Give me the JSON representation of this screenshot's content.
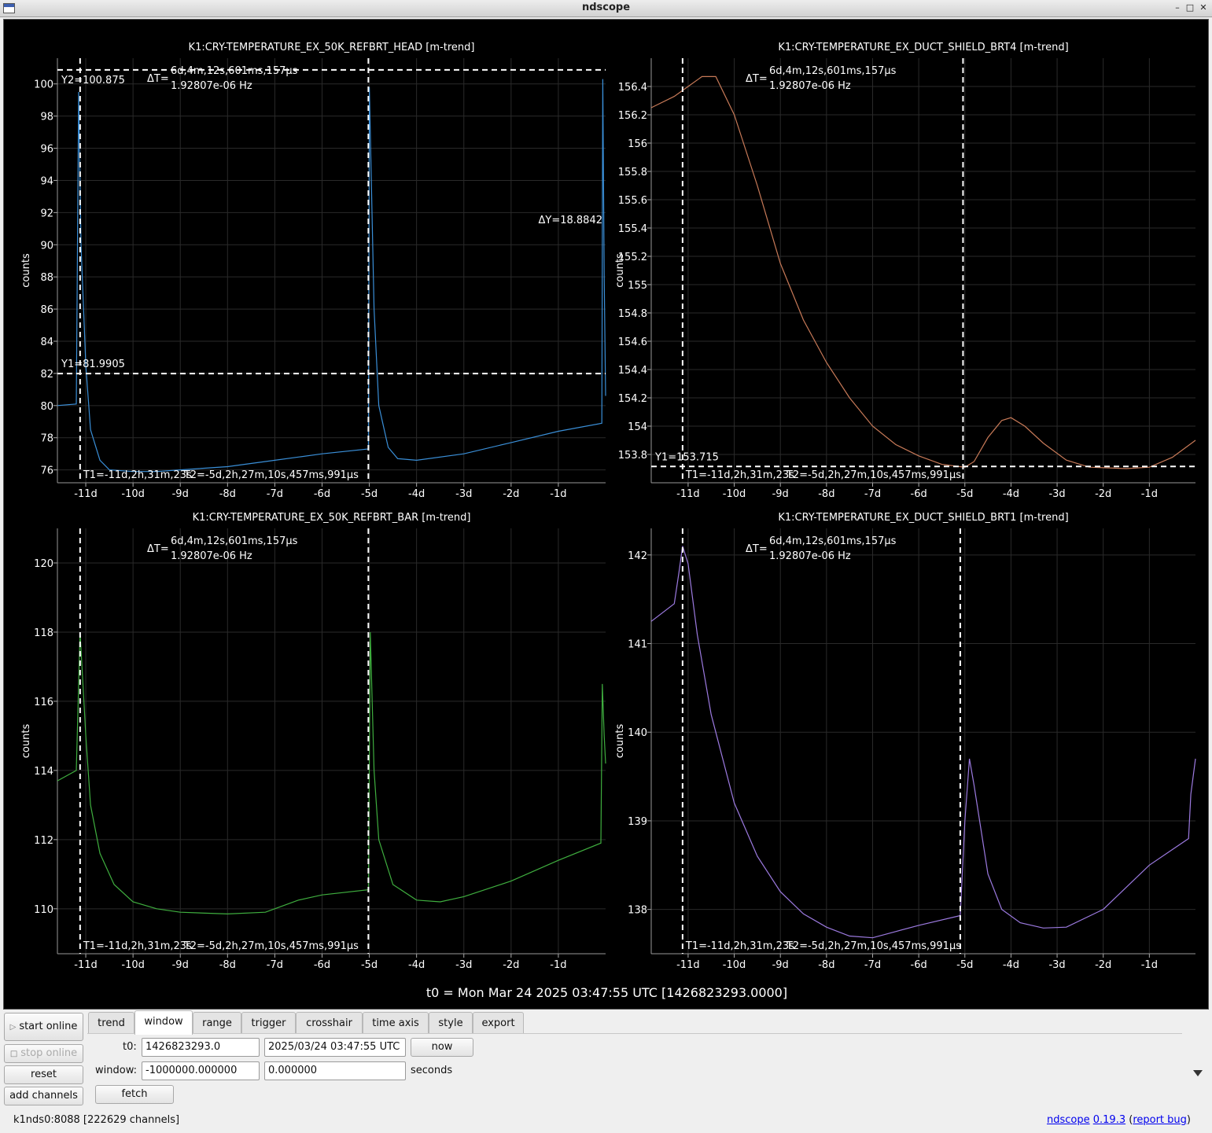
{
  "window": {
    "title": "ndscope"
  },
  "plots": [
    {
      "title": "K1:CRY-TEMPERATURE_EX_50K_REFBRT_HEAD [m-trend]",
      "ylabel": "counts",
      "color": "#3a8fd8",
      "ylim": [
        75.2,
        101.6
      ],
      "yticks": [
        "76",
        "78",
        "80",
        "82",
        "84",
        "86",
        "88",
        "90",
        "92",
        "94",
        "96",
        "98",
        "100"
      ],
      "xticks": [
        "-11d",
        "-10d",
        "-9d",
        "-8d",
        "-7d",
        "-6d",
        "-5d",
        "-4d",
        "-3d",
        "-2d",
        "-1d"
      ],
      "trace": [
        [
          -11.6,
          80.0
        ],
        [
          -11.2,
          80.1
        ],
        [
          -11.15,
          99.5
        ],
        [
          -11.1,
          90
        ],
        [
          -11.0,
          82.5
        ],
        [
          -10.9,
          78.5
        ],
        [
          -10.7,
          76.6
        ],
        [
          -10.5,
          76.0
        ],
        [
          -10.0,
          75.9
        ],
        [
          -9.5,
          75.9
        ],
        [
          -9.0,
          76.0
        ],
        [
          -8.0,
          76.2
        ],
        [
          -7.0,
          76.6
        ],
        [
          -6.0,
          77.0
        ],
        [
          -5.02,
          77.3
        ],
        [
          -5.0,
          99.8
        ],
        [
          -4.9,
          86
        ],
        [
          -4.8,
          80
        ],
        [
          -4.6,
          77.4
        ],
        [
          -4.4,
          76.7
        ],
        [
          -4.0,
          76.6
        ],
        [
          -3.0,
          77.0
        ],
        [
          -2.0,
          77.7
        ],
        [
          -1.0,
          78.4
        ],
        [
          -0.08,
          78.9
        ],
        [
          -0.06,
          100.3
        ],
        [
          -0.03,
          88
        ],
        [
          0.0,
          80.6
        ]
      ],
      "cursors": {
        "t1_label": "T1=-11d,2h,31m,23s",
        "t2_label": "T2=-5d,2h,27m,10s,457ms,991µs",
        "dt_label": "ΔT=",
        "dt_value": "6d,4m,12s,601ms,157µs",
        "dt_freq": "1.92807e-06 Hz",
        "y1_label": "Y1=81.9905",
        "y2_label": "Y2=100.875",
        "dy_label": "ΔY=18.8842",
        "y1": 81.9905,
        "y2": 100.875
      }
    },
    {
      "title": "K1:CRY-TEMPERATURE_EX_DUCT_SHIELD_BRT4 [m-trend]",
      "ylabel": "counts",
      "color": "#c87a58",
      "ylim": [
        153.6,
        156.6
      ],
      "yticks": [
        "153.8",
        "154",
        "154.2",
        "154.4",
        "154.6",
        "154.8",
        "155",
        "155.2",
        "155.4",
        "155.6",
        "155.8",
        "156",
        "156.2",
        "156.4"
      ],
      "xticks": [
        "-11d",
        "-10d",
        "-9d",
        "-8d",
        "-7d",
        "-6d",
        "-5d",
        "-4d",
        "-3d",
        "-2d",
        "-1d"
      ],
      "trace": [
        [
          -11.8,
          156.25
        ],
        [
          -11.3,
          156.33
        ],
        [
          -11.0,
          156.4
        ],
        [
          -10.7,
          156.47
        ],
        [
          -10.4,
          156.47
        ],
        [
          -10.0,
          156.2
        ],
        [
          -9.5,
          155.7
        ],
        [
          -9.0,
          155.15
        ],
        [
          -8.5,
          154.75
        ],
        [
          -8.0,
          154.45
        ],
        [
          -7.5,
          154.2
        ],
        [
          -7.0,
          154.0
        ],
        [
          -6.5,
          153.87
        ],
        [
          -6.0,
          153.79
        ],
        [
          -5.5,
          153.73
        ],
        [
          -5.0,
          153.71
        ],
        [
          -4.8,
          153.75
        ],
        [
          -4.5,
          153.92
        ],
        [
          -4.2,
          154.04
        ],
        [
          -4.0,
          154.06
        ],
        [
          -3.7,
          154.0
        ],
        [
          -3.3,
          153.88
        ],
        [
          -2.8,
          153.76
        ],
        [
          -2.3,
          153.71
        ],
        [
          -1.5,
          153.7
        ],
        [
          -1.0,
          153.71
        ],
        [
          -0.5,
          153.78
        ],
        [
          0.0,
          153.9
        ]
      ],
      "cursors": {
        "t1_label": "T1=-11d,2h,31m,23s",
        "t2_label": "T2=-5d,2h,27m,10s,457ms,991µs",
        "dt_label": "ΔT=",
        "dt_value": "6d,4m,12s,601ms,157µs",
        "dt_freq": "1.92807e-06 Hz",
        "y1_label": "Y1=153.715",
        "y1": 153.715
      }
    },
    {
      "title": "K1:CRY-TEMPERATURE_EX_50K_REFBRT_BAR [m-trend]",
      "ylabel": "counts",
      "color": "#3fae3f",
      "ylim": [
        108.7,
        121.0
      ],
      "yticks": [
        "110",
        "112",
        "114",
        "116",
        "118",
        "120"
      ],
      "xticks": [
        "-11d",
        "-10d",
        "-9d",
        "-8d",
        "-7d",
        "-6d",
        "-5d",
        "-4d",
        "-3d",
        "-2d",
        "-1d"
      ],
      "trace": [
        [
          -11.6,
          113.7
        ],
        [
          -11.2,
          114.0
        ],
        [
          -11.12,
          118.0
        ],
        [
          -11.0,
          115.0
        ],
        [
          -10.9,
          113.0
        ],
        [
          -10.7,
          111.6
        ],
        [
          -10.4,
          110.7
        ],
        [
          -10.0,
          110.2
        ],
        [
          -9.5,
          110.0
        ],
        [
          -9.0,
          109.9
        ],
        [
          -8.0,
          109.85
        ],
        [
          -7.2,
          109.9
        ],
        [
          -7.0,
          110.0
        ],
        [
          -6.5,
          110.25
        ],
        [
          -6.0,
          110.4
        ],
        [
          -5.02,
          110.55
        ],
        [
          -4.98,
          118.0
        ],
        [
          -4.9,
          114.0
        ],
        [
          -4.8,
          112.0
        ],
        [
          -4.5,
          110.7
        ],
        [
          -4.0,
          110.25
        ],
        [
          -3.5,
          110.2
        ],
        [
          -3.0,
          110.35
        ],
        [
          -2.0,
          110.8
        ],
        [
          -1.0,
          111.4
        ],
        [
          -0.1,
          111.9
        ],
        [
          -0.07,
          116.5
        ],
        [
          -0.03,
          115.0
        ],
        [
          0.0,
          114.2
        ]
      ],
      "cursors": {
        "t1_label": "T1=-11d,2h,31m,23s",
        "t2_label": "T2=-5d,2h,27m,10s,457ms,991µs",
        "dt_label": "ΔT=",
        "dt_value": "6d,4m,12s,601ms,157µs",
        "dt_freq": "1.92807e-06 Hz"
      }
    },
    {
      "title": "K1:CRY-TEMPERATURE_EX_DUCT_SHIELD_BRT1 [m-trend]",
      "ylabel": "counts",
      "color": "#9c7ae0",
      "ylim": [
        137.5,
        142.3
      ],
      "yticks": [
        "138",
        "139",
        "140",
        "141",
        "142"
      ],
      "xticks": [
        "-11d",
        "-10d",
        "-9d",
        "-8d",
        "-7d",
        "-6d",
        "-5d",
        "-4d",
        "-3d",
        "-2d",
        "-1d"
      ],
      "trace": [
        [
          -11.8,
          141.25
        ],
        [
          -11.3,
          141.45
        ],
        [
          -11.2,
          141.8
        ],
        [
          -11.12,
          142.1
        ],
        [
          -11.0,
          141.9
        ],
        [
          -10.8,
          141.1
        ],
        [
          -10.5,
          140.2
        ],
        [
          -10.0,
          139.2
        ],
        [
          -9.5,
          138.6
        ],
        [
          -9.0,
          138.2
        ],
        [
          -8.5,
          137.95
        ],
        [
          -8.0,
          137.8
        ],
        [
          -7.5,
          137.7
        ],
        [
          -7.0,
          137.68
        ],
        [
          -6.5,
          137.75
        ],
        [
          -6.0,
          137.82
        ],
        [
          -5.1,
          137.93
        ],
        [
          -5.0,
          139.0
        ],
        [
          -4.9,
          139.7
        ],
        [
          -4.8,
          139.4
        ],
        [
          -4.5,
          138.4
        ],
        [
          -4.2,
          138.0
        ],
        [
          -3.8,
          137.85
        ],
        [
          -3.3,
          137.79
        ],
        [
          -2.8,
          137.8
        ],
        [
          -2.0,
          138.0
        ],
        [
          -1.0,
          138.5
        ],
        [
          -0.15,
          138.8
        ],
        [
          -0.1,
          139.3
        ],
        [
          0.0,
          139.7
        ]
      ],
      "cursors": {
        "t1_label": "T1=-11d,2h,31m,23s",
        "t2_label": "T2=-5d,2h,27m,10s,457ms,991µs",
        "dt_label": "ΔT=",
        "dt_value": "6d,4m,12s,601ms,157µs",
        "dt_freq": "1.92807e-06 Hz"
      }
    }
  ],
  "t0_label": "t0 = Mon Mar 24 2025 03:47:55 UTC [1426823293.0000]",
  "controls": {
    "start_online": "start online",
    "stop_online": "stop online",
    "reset": "reset",
    "add_channels": "add channels",
    "tabs": [
      "trend",
      "window",
      "range",
      "trigger",
      "crosshair",
      "time axis",
      "style",
      "export"
    ],
    "active_tab": "window",
    "t0_label": "t0:",
    "t0_gps": "1426823293.0",
    "t0_utc": "2025/03/24 03:47:55 UTC",
    "now": "now",
    "window_label": "window:",
    "window_start": "-1000000.000000",
    "window_end": "0.000000",
    "seconds": "seconds",
    "fetch": "fetch"
  },
  "status": {
    "server": "k1nds0:8088  [222629 channels]",
    "app_link": "ndscope",
    "version": "0.19.3",
    "open_paren": " (",
    "report_bug": "report bug",
    "close_paren": ")"
  }
}
